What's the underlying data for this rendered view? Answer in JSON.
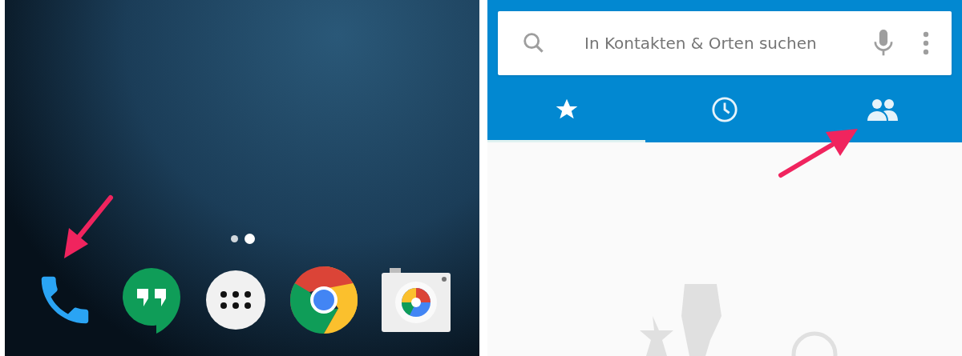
{
  "home_screen": {
    "page_dots": [
      {
        "selected": false
      },
      {
        "selected": true
      }
    ],
    "dock": [
      {
        "kind": "phone"
      },
      {
        "kind": "chat"
      },
      {
        "kind": "apps"
      },
      {
        "kind": "browser"
      },
      {
        "kind": "camera"
      }
    ]
  },
  "dialer": {
    "search": {
      "placeholder": "In Kontakten & Orten suchen"
    },
    "tabs": [
      {
        "kind": "favorites",
        "selected": true
      },
      {
        "kind": "recents",
        "selected": false
      },
      {
        "kind": "contacts",
        "selected": false
      }
    ]
  }
}
